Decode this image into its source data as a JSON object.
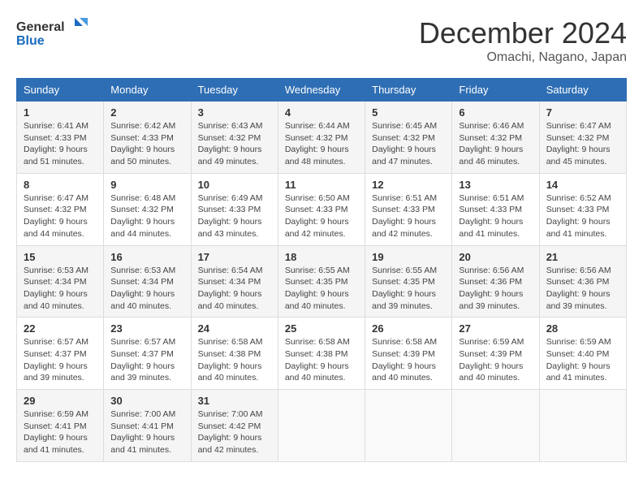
{
  "header": {
    "logo_line1": "General",
    "logo_line2": "Blue",
    "month": "December 2024",
    "location": "Omachi, Nagano, Japan"
  },
  "weekdays": [
    "Sunday",
    "Monday",
    "Tuesday",
    "Wednesday",
    "Thursday",
    "Friday",
    "Saturday"
  ],
  "weeks": [
    [
      {
        "day": "1",
        "sunrise": "6:41 AM",
        "sunset": "4:33 PM",
        "daylight": "9 hours and 51 minutes."
      },
      {
        "day": "2",
        "sunrise": "6:42 AM",
        "sunset": "4:33 PM",
        "daylight": "9 hours and 50 minutes."
      },
      {
        "day": "3",
        "sunrise": "6:43 AM",
        "sunset": "4:32 PM",
        "daylight": "9 hours and 49 minutes."
      },
      {
        "day": "4",
        "sunrise": "6:44 AM",
        "sunset": "4:32 PM",
        "daylight": "9 hours and 48 minutes."
      },
      {
        "day": "5",
        "sunrise": "6:45 AM",
        "sunset": "4:32 PM",
        "daylight": "9 hours and 47 minutes."
      },
      {
        "day": "6",
        "sunrise": "6:46 AM",
        "sunset": "4:32 PM",
        "daylight": "9 hours and 46 minutes."
      },
      {
        "day": "7",
        "sunrise": "6:47 AM",
        "sunset": "4:32 PM",
        "daylight": "9 hours and 45 minutes."
      }
    ],
    [
      {
        "day": "8",
        "sunrise": "6:47 AM",
        "sunset": "4:32 PM",
        "daylight": "9 hours and 44 minutes."
      },
      {
        "day": "9",
        "sunrise": "6:48 AM",
        "sunset": "4:32 PM",
        "daylight": "9 hours and 44 minutes."
      },
      {
        "day": "10",
        "sunrise": "6:49 AM",
        "sunset": "4:33 PM",
        "daylight": "9 hours and 43 minutes."
      },
      {
        "day": "11",
        "sunrise": "6:50 AM",
        "sunset": "4:33 PM",
        "daylight": "9 hours and 42 minutes."
      },
      {
        "day": "12",
        "sunrise": "6:51 AM",
        "sunset": "4:33 PM",
        "daylight": "9 hours and 42 minutes."
      },
      {
        "day": "13",
        "sunrise": "6:51 AM",
        "sunset": "4:33 PM",
        "daylight": "9 hours and 41 minutes."
      },
      {
        "day": "14",
        "sunrise": "6:52 AM",
        "sunset": "4:33 PM",
        "daylight": "9 hours and 41 minutes."
      }
    ],
    [
      {
        "day": "15",
        "sunrise": "6:53 AM",
        "sunset": "4:34 PM",
        "daylight": "9 hours and 40 minutes."
      },
      {
        "day": "16",
        "sunrise": "6:53 AM",
        "sunset": "4:34 PM",
        "daylight": "9 hours and 40 minutes."
      },
      {
        "day": "17",
        "sunrise": "6:54 AM",
        "sunset": "4:34 PM",
        "daylight": "9 hours and 40 minutes."
      },
      {
        "day": "18",
        "sunrise": "6:55 AM",
        "sunset": "4:35 PM",
        "daylight": "9 hours and 40 minutes."
      },
      {
        "day": "19",
        "sunrise": "6:55 AM",
        "sunset": "4:35 PM",
        "daylight": "9 hours and 39 minutes."
      },
      {
        "day": "20",
        "sunrise": "6:56 AM",
        "sunset": "4:36 PM",
        "daylight": "9 hours and 39 minutes."
      },
      {
        "day": "21",
        "sunrise": "6:56 AM",
        "sunset": "4:36 PM",
        "daylight": "9 hours and 39 minutes."
      }
    ],
    [
      {
        "day": "22",
        "sunrise": "6:57 AM",
        "sunset": "4:37 PM",
        "daylight": "9 hours and 39 minutes."
      },
      {
        "day": "23",
        "sunrise": "6:57 AM",
        "sunset": "4:37 PM",
        "daylight": "9 hours and 39 minutes."
      },
      {
        "day": "24",
        "sunrise": "6:58 AM",
        "sunset": "4:38 PM",
        "daylight": "9 hours and 40 minutes."
      },
      {
        "day": "25",
        "sunrise": "6:58 AM",
        "sunset": "4:38 PM",
        "daylight": "9 hours and 40 minutes."
      },
      {
        "day": "26",
        "sunrise": "6:58 AM",
        "sunset": "4:39 PM",
        "daylight": "9 hours and 40 minutes."
      },
      {
        "day": "27",
        "sunrise": "6:59 AM",
        "sunset": "4:39 PM",
        "daylight": "9 hours and 40 minutes."
      },
      {
        "day": "28",
        "sunrise": "6:59 AM",
        "sunset": "4:40 PM",
        "daylight": "9 hours and 41 minutes."
      }
    ],
    [
      {
        "day": "29",
        "sunrise": "6:59 AM",
        "sunset": "4:41 PM",
        "daylight": "9 hours and 41 minutes."
      },
      {
        "day": "30",
        "sunrise": "7:00 AM",
        "sunset": "4:41 PM",
        "daylight": "9 hours and 41 minutes."
      },
      {
        "day": "31",
        "sunrise": "7:00 AM",
        "sunset": "4:42 PM",
        "daylight": "9 hours and 42 minutes."
      },
      null,
      null,
      null,
      null
    ]
  ],
  "labels": {
    "sunrise": "Sunrise:",
    "sunset": "Sunset:",
    "daylight": "Daylight:"
  }
}
